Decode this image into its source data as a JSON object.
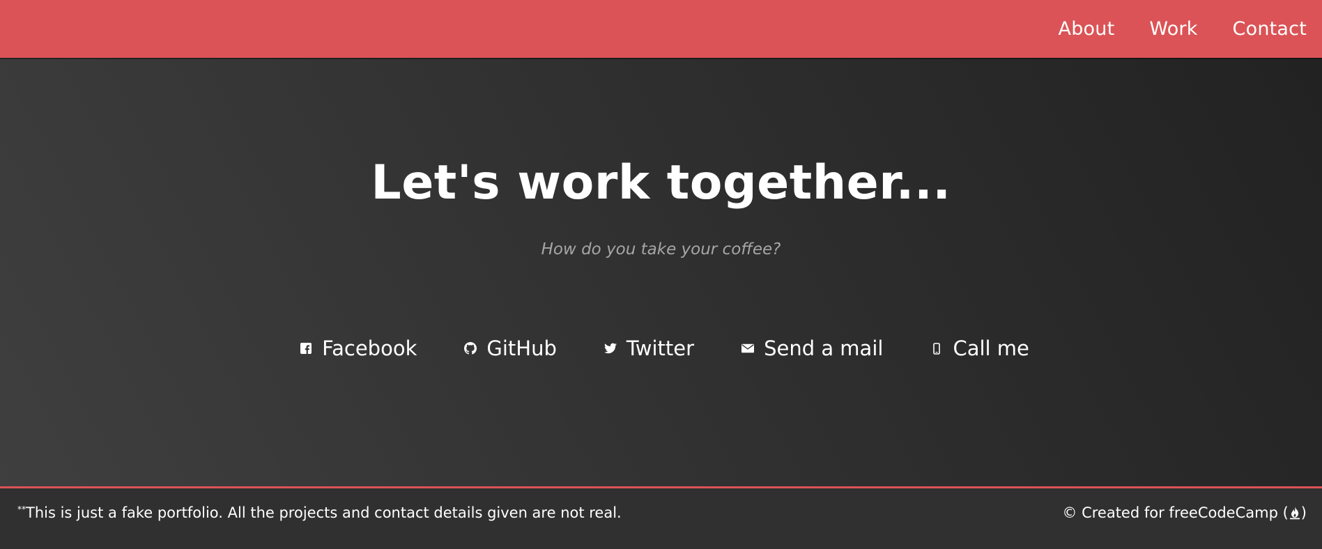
{
  "nav": {
    "items": [
      {
        "label": "About"
      },
      {
        "label": "Work"
      },
      {
        "label": "Contact"
      }
    ]
  },
  "contact": {
    "headline": "Let's work together...",
    "subline": "How do you take your coffee?",
    "links": [
      {
        "label": "Facebook",
        "icon": "facebook-icon"
      },
      {
        "label": "GitHub",
        "icon": "github-icon"
      },
      {
        "label": "Twitter",
        "icon": "twitter-icon"
      },
      {
        "label": "Send a mail",
        "icon": "envelope-icon"
      },
      {
        "label": "Call me",
        "icon": "mobile-phone-icon"
      }
    ]
  },
  "footer": {
    "note_mark": "**",
    "note": "This is just a fake portfolio. All the projects and contact details given are not real.",
    "credit_prefix": "© Created for",
    "credit_link": "freeCodeCamp",
    "credit_icon": "freecodecamp-fire-icon"
  },
  "colors": {
    "accent": "#db5356",
    "background": "#303030",
    "muted_text": "#a6a6a6",
    "text": "#ffffff"
  }
}
